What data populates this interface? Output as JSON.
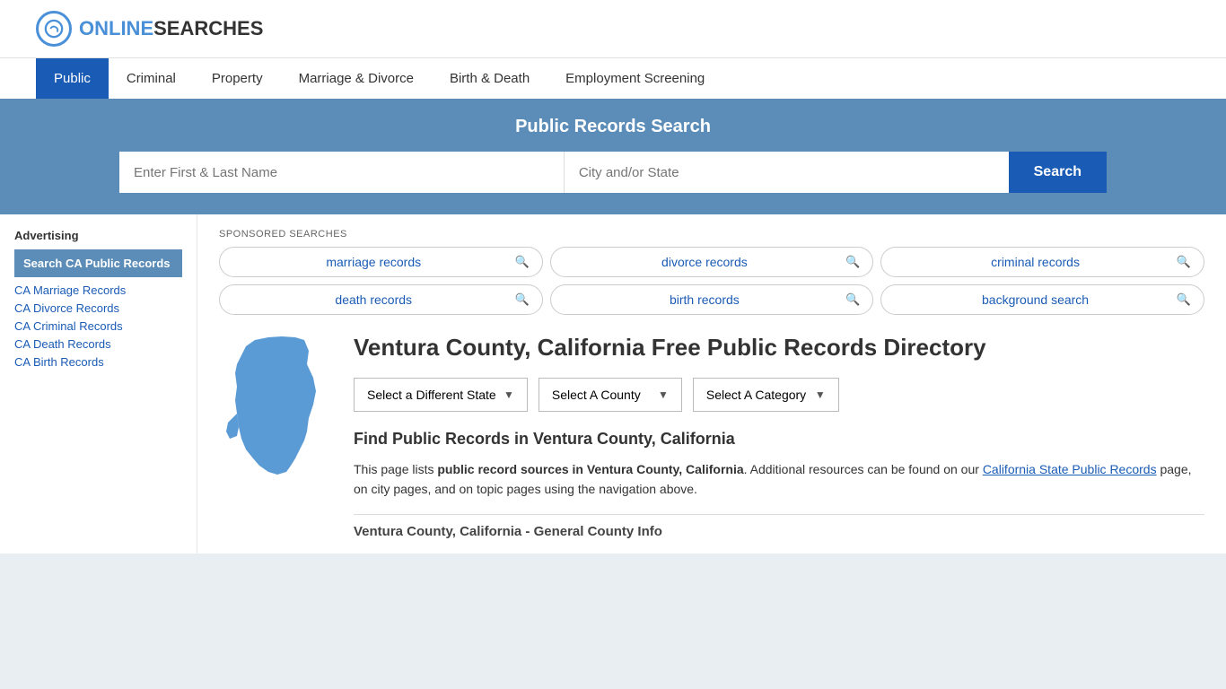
{
  "header": {
    "logo_text_part1": "ONLINE",
    "logo_text_part2": "SEARCHES"
  },
  "nav": {
    "items": [
      {
        "label": "Public",
        "active": true
      },
      {
        "label": "Criminal",
        "active": false
      },
      {
        "label": "Property",
        "active": false
      },
      {
        "label": "Marriage & Divorce",
        "active": false
      },
      {
        "label": "Birth & Death",
        "active": false
      },
      {
        "label": "Employment Screening",
        "active": false
      }
    ]
  },
  "search_banner": {
    "title": "Public Records Search",
    "name_placeholder": "Enter First & Last Name",
    "location_placeholder": "City and/or State",
    "button_label": "Search"
  },
  "sponsored": {
    "label": "SPONSORED SEARCHES",
    "items": [
      {
        "label": "marriage records"
      },
      {
        "label": "divorce records"
      },
      {
        "label": "criminal records"
      },
      {
        "label": "death records"
      },
      {
        "label": "birth records"
      },
      {
        "label": "background search"
      }
    ]
  },
  "sidebar": {
    "ad_label": "Advertising",
    "featured_label": "Search CA Public Records",
    "links": [
      {
        "label": "CA Marriage Records"
      },
      {
        "label": "CA Divorce Records"
      },
      {
        "label": "CA Criminal Records"
      },
      {
        "label": "CA Death Records"
      },
      {
        "label": "CA Birth Records"
      }
    ]
  },
  "page": {
    "title": "Ventura County, California Free Public Records Directory",
    "dropdowns": {
      "state_label": "Select a Different State",
      "county_label": "Select A County",
      "category_label": "Select A Category"
    },
    "section_title": "Find Public Records in Ventura County, California",
    "description_part1": "This page lists ",
    "description_bold": "public record sources in Ventura County, California",
    "description_part2": ". Additional resources can be found on our ",
    "description_link": "California State Public Records",
    "description_part3": " page, on city pages, and on topic pages using the navigation above.",
    "county_info_title": "Ventura County, California - General County Info"
  }
}
